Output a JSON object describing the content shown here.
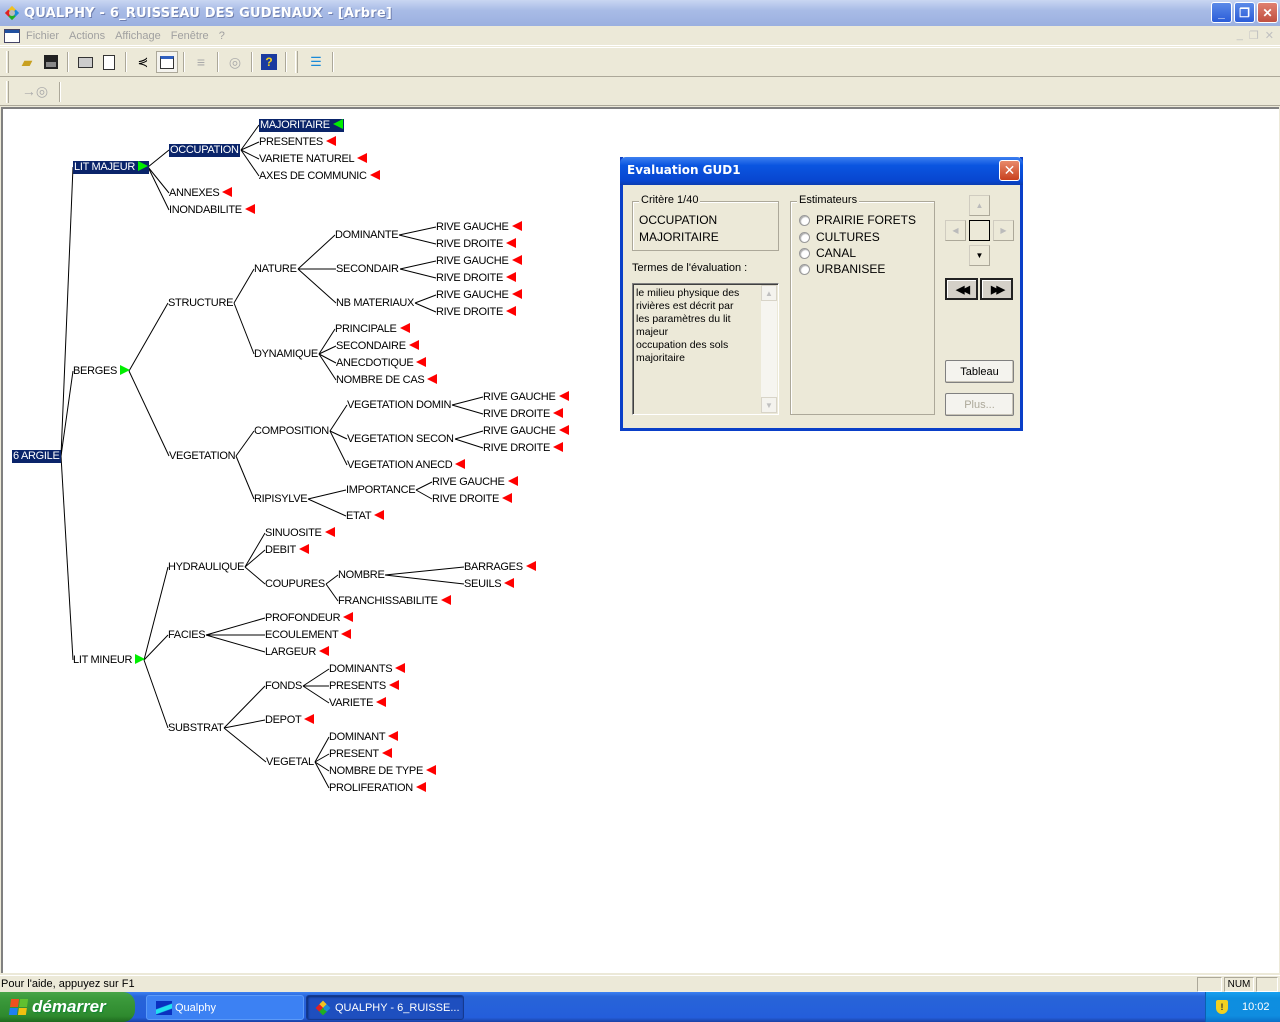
{
  "window": {
    "title": "QUALPHY - 6_RUISSEAU DES GUDENAUX - [Arbre]",
    "buttons": {
      "minimize": "_",
      "restore": "❐",
      "close": "✕"
    }
  },
  "menubar": {
    "items": [
      "Fichier",
      "Actions",
      "Affichage",
      "Fenêtre",
      "?"
    ]
  },
  "toolbar": {
    "buttons": [
      {
        "name": "open-icon",
        "glyph": "📂"
      },
      {
        "name": "save-icon",
        "glyph": "💾"
      },
      {
        "name": "print-icon",
        "glyph": "🖶"
      },
      {
        "name": "print-preview-icon",
        "glyph": "🔍"
      },
      {
        "name": "tree-icon",
        "glyph": "⋞"
      },
      {
        "name": "tree-window-icon",
        "glyph": "▣"
      },
      {
        "name": "sort-icon",
        "glyph": "≡"
      },
      {
        "name": "target-icon",
        "glyph": "◎"
      },
      {
        "name": "help-icon",
        "glyph": "?"
      },
      {
        "name": "indent-list-icon",
        "glyph": "☰"
      }
    ],
    "toolbar2_glyph": "→◎"
  },
  "tree": {
    "root": "6 ARGILE",
    "nodes": [
      {
        "id": "root",
        "label": "6 ARGILE",
        "selected": true,
        "marker": "none"
      },
      {
        "id": "litmaj",
        "label": "LIT MAJEUR",
        "selected": true,
        "marker": "green-r"
      },
      {
        "id": "occ",
        "label": "OCCUPATION",
        "selected": true,
        "marker": "none"
      },
      {
        "id": "majo",
        "label": "MAJORITAIRE",
        "selected": true,
        "marker": "green-l"
      },
      {
        "id": "pres",
        "label": "PRESENTES",
        "marker": "red"
      },
      {
        "id": "varnat",
        "label": "VARIETE NATUREL",
        "marker": "red"
      },
      {
        "id": "axes",
        "label": "AXES DE COMMUNIC",
        "marker": "red"
      },
      {
        "id": "annexes",
        "label": "ANNEXES",
        "marker": "red"
      },
      {
        "id": "inond",
        "label": "INONDABILITE",
        "marker": "red"
      },
      {
        "id": "berges",
        "label": "BERGES",
        "marker": "green-r"
      },
      {
        "id": "struct",
        "label": "STRUCTURE",
        "marker": "none"
      },
      {
        "id": "nature",
        "label": "NATURE",
        "marker": "none"
      },
      {
        "id": "domin",
        "label": "DOMINANTE",
        "marker": "none"
      },
      {
        "id": "rg1",
        "label": "RIVE GAUCHE",
        "marker": "red"
      },
      {
        "id": "rd1",
        "label": "RIVE DROITE",
        "marker": "red"
      },
      {
        "id": "second",
        "label": "SECONDAIR",
        "marker": "none"
      },
      {
        "id": "rg2",
        "label": "RIVE GAUCHE",
        "marker": "red"
      },
      {
        "id": "rd2",
        "label": "RIVE DROITE",
        "marker": "red"
      },
      {
        "id": "nbmat",
        "label": "NB MATERIAUX",
        "marker": "none"
      },
      {
        "id": "rg3",
        "label": "RIVE GAUCHE",
        "marker": "red"
      },
      {
        "id": "rd3",
        "label": "RIVE DROITE",
        "marker": "red"
      },
      {
        "id": "dyn",
        "label": "DYNAMIQUE",
        "marker": "none"
      },
      {
        "id": "princ",
        "label": "PRINCIPALE",
        "marker": "red"
      },
      {
        "id": "secd",
        "label": "SECONDAIRE",
        "marker": "red"
      },
      {
        "id": "anec",
        "label": "ANECDOTIQUE",
        "marker": "red"
      },
      {
        "id": "nbcas",
        "label": "NOMBRE DE CAS",
        "marker": "red"
      },
      {
        "id": "veg",
        "label": "VEGETATION",
        "marker": "none"
      },
      {
        "id": "compo",
        "label": "COMPOSITION",
        "marker": "none"
      },
      {
        "id": "vdom",
        "label": "VEGETATION DOMIN",
        "marker": "none"
      },
      {
        "id": "rg4",
        "label": "RIVE GAUCHE",
        "marker": "red"
      },
      {
        "id": "rd4",
        "label": "RIVE DROITE",
        "marker": "red"
      },
      {
        "id": "vsec",
        "label": "VEGETATION SECON",
        "marker": "none"
      },
      {
        "id": "rg5",
        "label": "RIVE GAUCHE",
        "marker": "red"
      },
      {
        "id": "rd5",
        "label": "RIVE DROITE",
        "marker": "red"
      },
      {
        "id": "vanec",
        "label": "VEGETATION ANECD",
        "marker": "red"
      },
      {
        "id": "ripi",
        "label": "RIPISYLVE",
        "marker": "none"
      },
      {
        "id": "impo",
        "label": "IMPORTANCE",
        "marker": "none"
      },
      {
        "id": "rg6",
        "label": "RIVE GAUCHE",
        "marker": "red"
      },
      {
        "id": "rd6",
        "label": "RIVE DROITE",
        "marker": "red"
      },
      {
        "id": "etat",
        "label": "ETAT",
        "marker": "red"
      },
      {
        "id": "litmin",
        "label": "LIT MINEUR",
        "marker": "green-r"
      },
      {
        "id": "hydr",
        "label": "HYDRAULIQUE",
        "marker": "none"
      },
      {
        "id": "sinu",
        "label": "SINUOSITE",
        "marker": "red"
      },
      {
        "id": "debit",
        "label": "DEBIT",
        "marker": "red"
      },
      {
        "id": "coup",
        "label": "COUPURES",
        "marker": "none"
      },
      {
        "id": "nombre",
        "label": "NOMBRE",
        "marker": "none"
      },
      {
        "id": "barr",
        "label": "BARRAGES",
        "marker": "red"
      },
      {
        "id": "seuils",
        "label": "SEUILS",
        "marker": "red"
      },
      {
        "id": "franch",
        "label": "FRANCHISSABILITE",
        "marker": "red"
      },
      {
        "id": "facies",
        "label": "FACIES",
        "marker": "none"
      },
      {
        "id": "prof",
        "label": "PROFONDEUR",
        "marker": "red"
      },
      {
        "id": "ecoul",
        "label": "ECOULEMENT",
        "marker": "red"
      },
      {
        "id": "larg",
        "label": "LARGEUR",
        "marker": "red"
      },
      {
        "id": "subst",
        "label": "SUBSTRAT",
        "marker": "none"
      },
      {
        "id": "fonds",
        "label": "FONDS",
        "marker": "none"
      },
      {
        "id": "doms",
        "label": "DOMINANTS",
        "marker": "red"
      },
      {
        "id": "press",
        "label": "PRESENTS",
        "marker": "red"
      },
      {
        "id": "vari",
        "label": "VARIETE",
        "marker": "red"
      },
      {
        "id": "depot",
        "label": "DEPOT",
        "marker": "red"
      },
      {
        "id": "vegetal",
        "label": "VEGETAL",
        "marker": "none"
      },
      {
        "id": "dom",
        "label": "DOMINANT",
        "marker": "red"
      },
      {
        "id": "present",
        "label": "PRESENT",
        "marker": "red"
      },
      {
        "id": "nbtype",
        "label": "NOMBRE DE TYPE",
        "marker": "red"
      },
      {
        "id": "prolif",
        "label": "PROLIFERATION",
        "marker": "red"
      }
    ],
    "edges": [
      [
        "root",
        "litmaj"
      ],
      [
        "root",
        "berges"
      ],
      [
        "root",
        "litmin"
      ],
      [
        "litmaj",
        "occ"
      ],
      [
        "litmaj",
        "annexes"
      ],
      [
        "litmaj",
        "inond"
      ],
      [
        "occ",
        "majo"
      ],
      [
        "occ",
        "pres"
      ],
      [
        "occ",
        "varnat"
      ],
      [
        "occ",
        "axes"
      ],
      [
        "berges",
        "struct"
      ],
      [
        "berges",
        "veg"
      ],
      [
        "struct",
        "nature"
      ],
      [
        "struct",
        "dyn"
      ],
      [
        "nature",
        "domin"
      ],
      [
        "nature",
        "second"
      ],
      [
        "nature",
        "nbmat"
      ],
      [
        "domin",
        "rg1"
      ],
      [
        "domin",
        "rd1"
      ],
      [
        "second",
        "rg2"
      ],
      [
        "second",
        "rd2"
      ],
      [
        "nbmat",
        "rg3"
      ],
      [
        "nbmat",
        "rd3"
      ],
      [
        "dyn",
        "princ"
      ],
      [
        "dyn",
        "secd"
      ],
      [
        "dyn",
        "anec"
      ],
      [
        "dyn",
        "nbcas"
      ],
      [
        "veg",
        "compo"
      ],
      [
        "veg",
        "ripi"
      ],
      [
        "compo",
        "vdom"
      ],
      [
        "compo",
        "vsec"
      ],
      [
        "compo",
        "vanec"
      ],
      [
        "vdom",
        "rg4"
      ],
      [
        "vdom",
        "rd4"
      ],
      [
        "vsec",
        "rg5"
      ],
      [
        "vsec",
        "rd5"
      ],
      [
        "ripi",
        "impo"
      ],
      [
        "ripi",
        "etat"
      ],
      [
        "impo",
        "rg6"
      ],
      [
        "impo",
        "rd6"
      ],
      [
        "litmin",
        "hydr"
      ],
      [
        "litmin",
        "facies"
      ],
      [
        "litmin",
        "subst"
      ],
      [
        "hydr",
        "sinu"
      ],
      [
        "hydr",
        "debit"
      ],
      [
        "hydr",
        "coup"
      ],
      [
        "coup",
        "nombre"
      ],
      [
        "coup",
        "franch"
      ],
      [
        "nombre",
        "barr"
      ],
      [
        "nombre",
        "seuils"
      ],
      [
        "facies",
        "prof"
      ],
      [
        "facies",
        "ecoul"
      ],
      [
        "facies",
        "larg"
      ],
      [
        "subst",
        "fonds"
      ],
      [
        "subst",
        "depot"
      ],
      [
        "subst",
        "vegetal"
      ],
      [
        "fonds",
        "doms"
      ],
      [
        "fonds",
        "press"
      ],
      [
        "fonds",
        "vari"
      ],
      [
        "vegetal",
        "dom"
      ],
      [
        "vegetal",
        "present"
      ],
      [
        "vegetal",
        "nbtype"
      ],
      [
        "vegetal",
        "prolif"
      ]
    ]
  },
  "dialog": {
    "title": "Evaluation GUD1",
    "criterion": {
      "legend": "Critère 1/40",
      "line1": "OCCUPATION",
      "line2": "MAJORITAIRE"
    },
    "terms_label": "Termes de l'évaluation :",
    "terms_text": "le milieu physique des rivières est décrit par les paramètres du lit majeur occupation des sols majoritaire",
    "terms_lines": [
      "le milieu physique des",
      "rivières est décrit par",
      "les paramètres du lit",
      "majeur",
      "occupation des sols",
      "majoritaire"
    ],
    "estimators": {
      "legend": "Estimateurs",
      "options": [
        "PRAIRIE FORETS",
        "CULTURES",
        "CANAL",
        "URBANISEE"
      ]
    },
    "nav": {
      "up": "▲",
      "left": "◀",
      "right": "▶",
      "down": "▼",
      "first": "◀◀",
      "last": "▶▶"
    },
    "tableau_label": "Tableau",
    "plus_label": "Plus..."
  },
  "statusbar": {
    "help_text": "Pour l'aide, appuyez sur F1",
    "num": "NUM"
  },
  "taskbar": {
    "start_label": "démarrer",
    "items": [
      "Qualphy",
      "QUALPHY - 6_RUISSE..."
    ],
    "clock": "10:02"
  }
}
